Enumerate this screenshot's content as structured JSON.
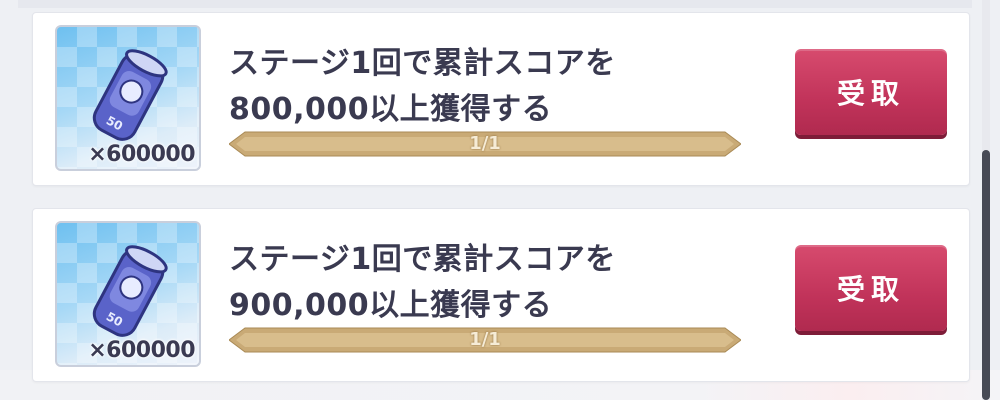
{
  "missions": [
    {
      "text_line1": "ステージ1回で累計スコアを",
      "text_line2": "800,000以上獲得する",
      "reward_quantity": "×600000",
      "reward_icon": "coin-can-icon",
      "progress_text": "1/1",
      "progress_fraction": 1.0,
      "claim_label": "受取"
    },
    {
      "text_line1": "ステージ1回で累計スコアを",
      "text_line2": "900,000以上獲得する",
      "reward_quantity": "×600000",
      "reward_icon": "coin-can-icon",
      "progress_text": "1/1",
      "progress_fraction": 1.0,
      "claim_label": "受取"
    }
  ],
  "colors": {
    "claim_button": "#c1335a",
    "progress_bar": "#c9aa76",
    "text": "#3a3a50"
  }
}
